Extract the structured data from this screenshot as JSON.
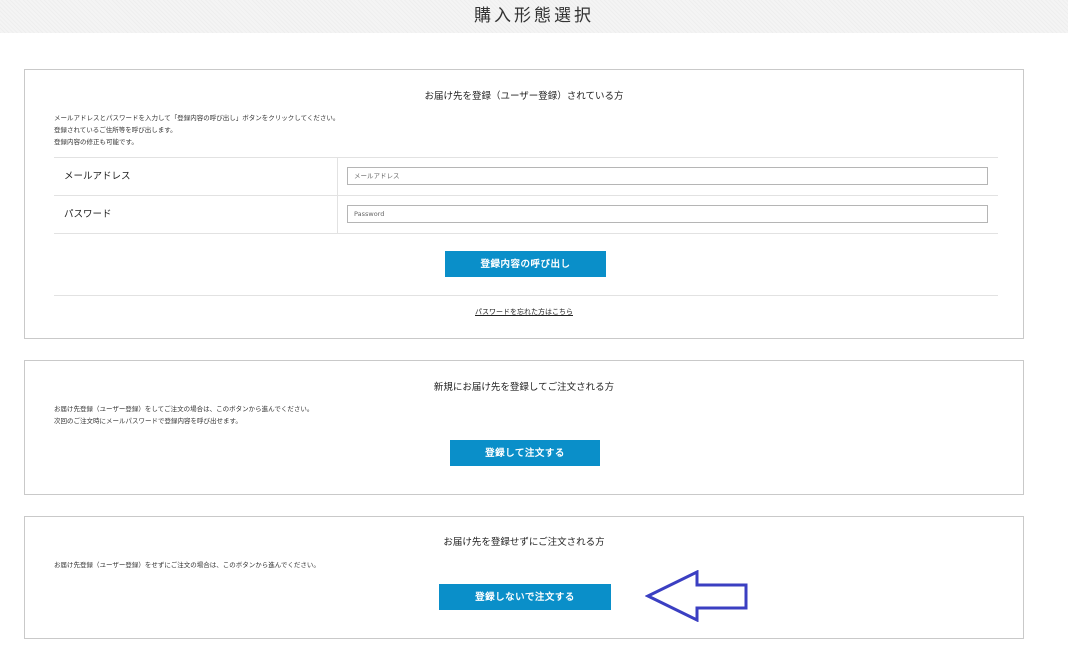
{
  "header": {
    "title": "購入形態選択"
  },
  "registered": {
    "title": "お届け先を登録（ユーザー登録）されている方",
    "description": [
      "メールアドレスとパスワードを入力して「登録内容の呼び出し」ボタンをクリックしてください。",
      "登録されているご住所等を呼び出します。",
      "登録内容の修正も可能です。"
    ],
    "email_label": "メールアドレス",
    "email_placeholder": "メールアドレス",
    "password_label": "パスワード",
    "password_placeholder": "Password",
    "button_label": "登録内容の呼び出し",
    "forgot_link": "パスワードを忘れた方はこちら"
  },
  "new_register": {
    "title": "新規にお届け先を登録してご注文される方",
    "description": [
      "お届け先登録（ユーザー登録）をしてご注文の場合は、このボタンから進んでください。",
      "次回のご注文時にメールパスワードで登録内容を呼び出せます。"
    ],
    "button_label": "登録して注文する"
  },
  "guest": {
    "title": "お届け先を登録せずにご注文される方",
    "description": [
      "お届け先登録（ユーザー登録）をせずにご注文の場合は、このボタンから進んでください。"
    ],
    "button_label": "登録しないで注文する"
  },
  "colors": {
    "button": "#0a8fc9",
    "arrow": "#3b3fc2",
    "border": "#c9c9c9"
  },
  "annotation": {
    "icon": "left-arrow-icon"
  }
}
